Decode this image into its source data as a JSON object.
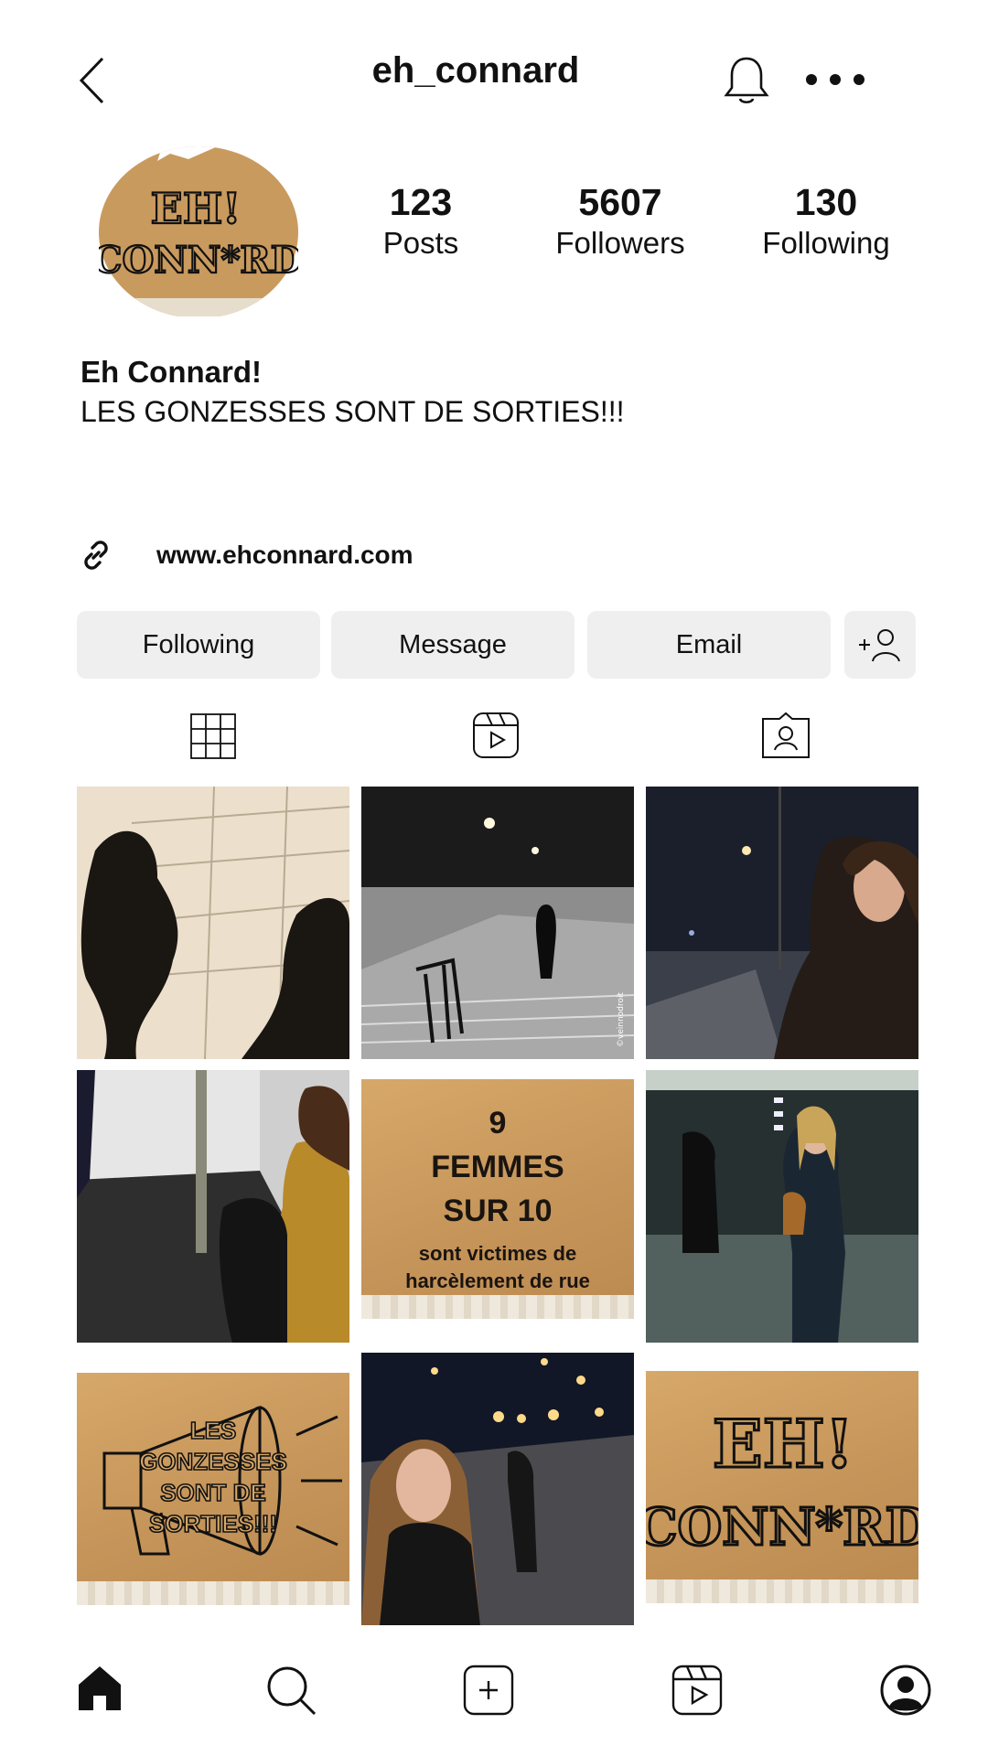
{
  "header": {
    "username": "eh_connard"
  },
  "profile": {
    "avatar_text_line1": "EH!",
    "avatar_text_line2": "CONN*RD",
    "stats": [
      {
        "value": "123",
        "label": "Posts"
      },
      {
        "value": "5607",
        "label": "Followers"
      },
      {
        "value": "130",
        "label": "Following"
      }
    ],
    "name": "Eh Connard!",
    "bio": "LES GONZESSES SONT DE SORTIES!!!",
    "link": "www.ehconnard.com"
  },
  "actions": {
    "following": "Following",
    "message": "Message",
    "email": "Email"
  },
  "posts": {
    "p5_line1": "9",
    "p5_line2": "FEMMES",
    "p5_line3": "SUR 10",
    "p5_line4": "sont victimes de",
    "p5_line5": "harcèlement de rue",
    "p7_line1": "LES",
    "p7_line2": "GONZESSES",
    "p7_line3": "SONT DE",
    "p7_line4": "SORTIES!!!",
    "p9_line1": "EH!",
    "p9_line2": "CONN*RD",
    "watermark": "©veinnodroit"
  },
  "icons": {
    "back": "chevron-left-icon",
    "bell": "bell-icon",
    "more": "more-dots-icon",
    "link": "link-icon",
    "add_user": "add-user-icon",
    "grid": "grid-icon",
    "reels": "reels-icon",
    "tagged": "tagged-icon",
    "home": "home-icon",
    "search": "search-icon",
    "create": "plus-square-icon",
    "profile": "profile-icon"
  }
}
